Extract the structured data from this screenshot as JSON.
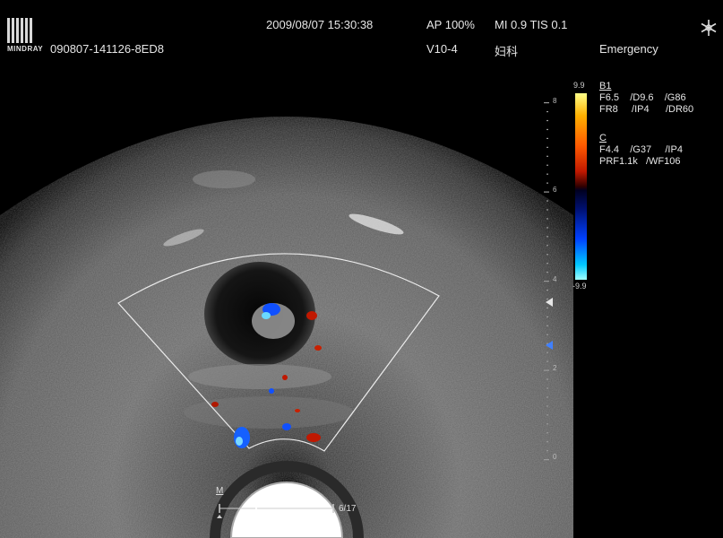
{
  "header": {
    "datetime": "2009/08/07 15:30:38",
    "ap": "AP  100%",
    "mi_tis": "MI 0.9  TIS 0.1",
    "patient_id": "090807-141126-8ED8",
    "probe": "V10-4",
    "exam": "妇科",
    "mode": "Emergency",
    "logo_text": "MINDRAY"
  },
  "colorbar": {
    "max": "9.9",
    "min": "-9.9",
    "colors": [
      "#ffff88",
      "#ff5a00",
      "#000000",
      "#0040ff",
      "#a0ffff"
    ]
  },
  "b_params": {
    "title": "B1",
    "line1": "F6.5    /D9.6    /G86",
    "line2": "FR8     /IP4      /DR60"
  },
  "c_params": {
    "title": "C",
    "line1": "F4.4    /G37     /IP4",
    "line2": "PRF1.1k   /WF106"
  },
  "depth_scale": [
    "8",
    "6",
    "4",
    "2",
    "0"
  ],
  "footer": {
    "mode_marker": "M",
    "frame_counter": "6/17"
  },
  "icons": {
    "settings": "snowflake-icon",
    "focus": "focus-triangle-icon"
  }
}
